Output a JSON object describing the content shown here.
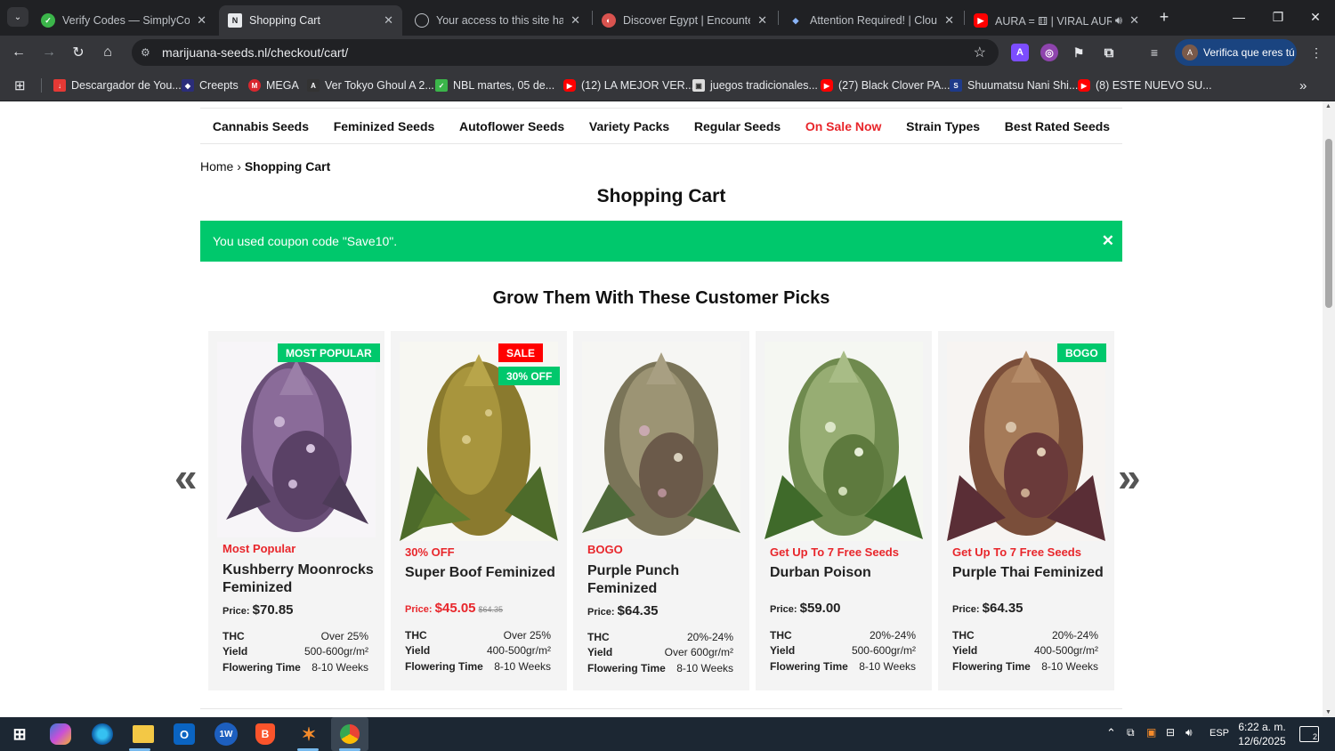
{
  "browser": {
    "tabs": [
      {
        "title": "Verify Codes — SimplyCodes",
        "active": false,
        "icon": "simplycodes-icon"
      },
      {
        "title": "Shopping Cart",
        "active": true,
        "icon": "site-icon"
      },
      {
        "title": "Your access to this site has b",
        "active": false,
        "icon": "globe-icon"
      },
      {
        "title": "Discover Egypt | Encounters",
        "active": false,
        "icon": "encounters-icon"
      },
      {
        "title": "Attention Required! | Cloudfl",
        "active": false,
        "icon": "cloudflare-icon"
      },
      {
        "title": "AURA = ⚅ | VIRAL AUR",
        "active": false,
        "icon": "youtube-icon"
      }
    ],
    "url": "marijuana-seeds.nl/checkout/cart/",
    "profile_label": "Verifica que eres tú",
    "profile_initial": "A",
    "ext_a_label": "A",
    "bookmarks": [
      {
        "label": "Descargador de You...",
        "color": "#e53935"
      },
      {
        "label": "Creepts",
        "color": "#2b2d7a"
      },
      {
        "label": "MEGA",
        "color": "#d9272e"
      },
      {
        "label": "Ver Tokyo Ghoul A 2...",
        "color": "#333333"
      },
      {
        "label": "NBL martes, 05 de...",
        "color": "#3bb54a"
      },
      {
        "label": "(12) LA MEJOR VER...",
        "color": "#ff0000"
      },
      {
        "label": "juegos tradicionales...",
        "color": "#dddddd"
      },
      {
        "label": "(27) Black Clover PA...",
        "color": "#ff0000"
      },
      {
        "label": "Shuumatsu Nani Shi...",
        "color": "#1e3a8a"
      },
      {
        "label": "(8) ESTE NUEVO SU...",
        "color": "#ff0000"
      }
    ]
  },
  "site": {
    "nav": [
      "Cannabis Seeds",
      "Feminized Seeds",
      "Autoflower Seeds",
      "Variety Packs",
      "Regular Seeds",
      "On Sale Now",
      "Strain Types",
      "Best Rated Seeds"
    ],
    "breadcrumb_home": "Home",
    "breadcrumb_current": "Shopping Cart",
    "page_title": "Shopping Cart",
    "notice": "You used coupon code \"Save10\".",
    "notice_close": "✕",
    "picks_title": "Grow Them With These Customer Picks",
    "prev_arrow": "«",
    "next_arrow": "»",
    "price_label": "Price:",
    "spec_thc": "THC",
    "spec_yield": "Yield",
    "spec_flower": "Flowering Time",
    "products": [
      {
        "badges": [
          "MOST POPULAR"
        ],
        "promo": "Most Popular",
        "name": "Kushberry Moonrocks Feminized",
        "price": "$70.85",
        "old_price": "",
        "thc": "Over 25%",
        "yield": "500-600gr/m²",
        "flowering": "8-10 Weeks"
      },
      {
        "badges": [
          "SALE",
          "30% OFF"
        ],
        "promo": "30% OFF",
        "name": "Super Boof Feminized",
        "price": "$45.05",
        "old_price": "$64.35",
        "thc": "Over 25%",
        "yield": "400-500gr/m²",
        "flowering": "8-10 Weeks"
      },
      {
        "badges": [],
        "promo": "BOGO",
        "name": "Purple Punch Feminized",
        "price": "$64.35",
        "old_price": "",
        "thc": "20%-24%",
        "yield": "Over 600gr/m²",
        "flowering": "8-10 Weeks"
      },
      {
        "badges": [],
        "promo": "Get Up To 7 Free Seeds",
        "name": "Durban Poison",
        "price": "$59.00",
        "old_price": "",
        "thc": "20%-24%",
        "yield": "500-600gr/m²",
        "flowering": "8-10 Weeks"
      },
      {
        "badges": [
          "BOGO"
        ],
        "promo": "Get Up To 7 Free Seeds",
        "name": "Purple Thai Feminized",
        "price": "$64.35",
        "old_price": "",
        "thc": "20%-24%",
        "yield": "400-500gr/m²",
        "flowering": "8-10 Weeks"
      }
    ]
  },
  "taskbar": {
    "lang": "ESP",
    "time": "6:22 a. m.",
    "date": "12/6/2025",
    "notifications": "2"
  },
  "colors": {
    "accent_green": "#00c86c",
    "sale_red": "#e8262b",
    "badge_red": "#ff0000"
  }
}
